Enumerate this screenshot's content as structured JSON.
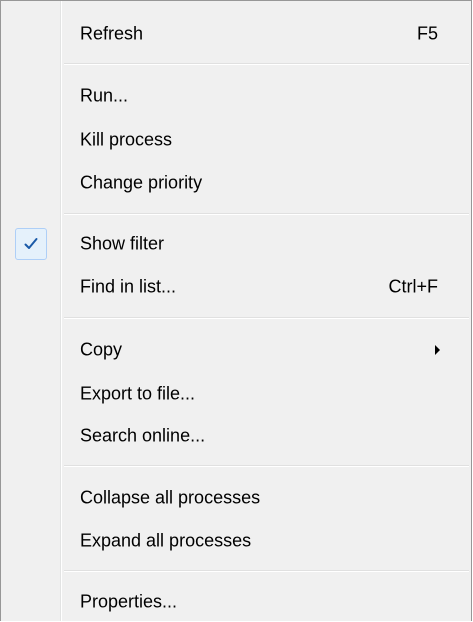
{
  "menu": {
    "refresh": {
      "label": "Refresh",
      "shortcut": "F5"
    },
    "run": {
      "label": "Run..."
    },
    "kill_process": {
      "label": "Kill process"
    },
    "change_priority": {
      "label": "Change priority"
    },
    "show_filter": {
      "label": "Show filter",
      "checked": true
    },
    "find_in_list": {
      "label": "Find in list...",
      "shortcut": "Ctrl+F"
    },
    "copy": {
      "label": "Copy",
      "submenu_icon": "chevron-right-icon"
    },
    "export_to_file": {
      "label": "Export to file..."
    },
    "search_online": {
      "label": "Search online..."
    },
    "collapse_all": {
      "label": "Collapse all processes"
    },
    "expand_all": {
      "label": "Expand all processes"
    },
    "properties": {
      "label": "Properties..."
    }
  },
  "colors": {
    "menu_bg": "#f0f0f0",
    "check_highlight": "#e5f1fb",
    "check_border": "#aecff7",
    "check_mark": "#1a5aa8"
  }
}
